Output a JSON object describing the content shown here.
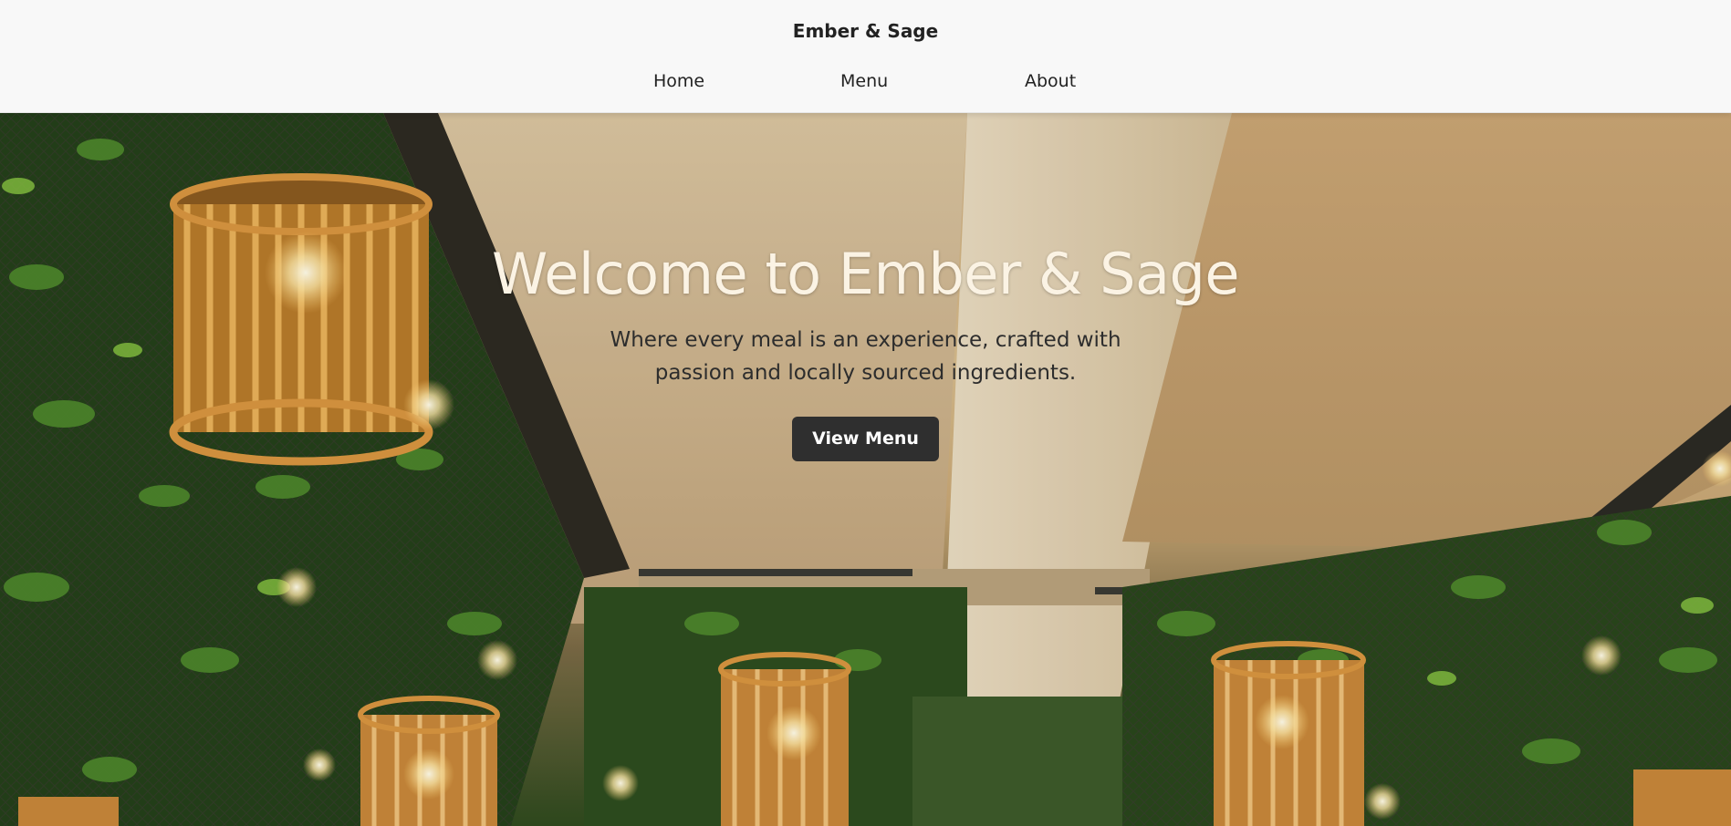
{
  "header": {
    "brand": "Ember & Sage",
    "nav": [
      {
        "label": "Home"
      },
      {
        "label": "Menu"
      },
      {
        "label": "About"
      }
    ]
  },
  "hero": {
    "title": "Welcome to Ember & Sage",
    "subtitle": "Where every meal is an experience, crafted with passion and locally sourced ingredients.",
    "cta_label": "View Menu",
    "background_image": "restaurant-ceiling-with-rattan-pendant-lamps-and-hanging-vines"
  },
  "colors": {
    "header_bg": "#f8f8f8",
    "button_bg": "#2f2f2f",
    "title_color": "#fbf3e4",
    "text_color": "#222222"
  }
}
